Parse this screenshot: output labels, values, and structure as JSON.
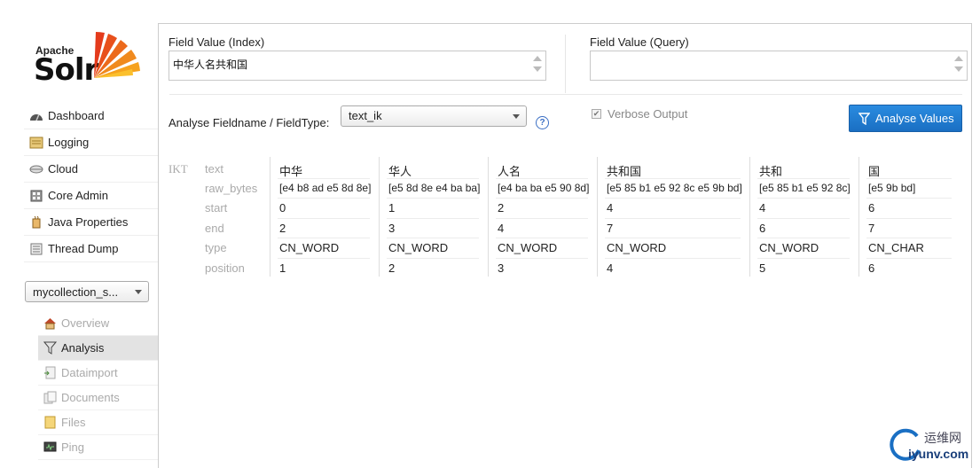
{
  "logo": {
    "apache": "Apache",
    "solr": "Solr"
  },
  "nav": [
    {
      "label": "Dashboard",
      "icon": "dashboard-icon"
    },
    {
      "label": "Logging",
      "icon": "logging-icon"
    },
    {
      "label": "Cloud",
      "icon": "cloud-icon"
    },
    {
      "label": "Core Admin",
      "icon": "core-admin-icon"
    },
    {
      "label": "Java Properties",
      "icon": "java-properties-icon"
    },
    {
      "label": "Thread Dump",
      "icon": "thread-dump-icon"
    }
  ],
  "core_selector": {
    "value": "mycollection_s..."
  },
  "core_menu": [
    {
      "label": "Overview",
      "icon": "home-icon",
      "active": false
    },
    {
      "label": "Analysis",
      "icon": "funnel-icon",
      "active": true
    },
    {
      "label": "Dataimport",
      "icon": "dataimport-icon",
      "active": false
    },
    {
      "label": "Documents",
      "icon": "documents-icon",
      "active": false
    },
    {
      "label": "Files",
      "icon": "files-icon",
      "active": false
    },
    {
      "label": "Ping",
      "icon": "ping-icon",
      "active": false
    }
  ],
  "analysis": {
    "index_label": "Field Value (Index)",
    "index_value": "中华人名共和国",
    "query_label": "Field Value (Query)",
    "query_value": "",
    "fieldtype_label": "Analyse Fieldname / FieldType:",
    "fieldtype_value": "text_ik",
    "verbose_label": "Verbose Output",
    "verbose_checked": true,
    "button_label": "Analyse Values",
    "button_color": "#1f7ad0"
  },
  "results": {
    "tokenizer": "IKT",
    "row_labels": [
      "text",
      "raw_bytes",
      "start",
      "end",
      "type",
      "position"
    ],
    "tokens": [
      {
        "text": "中华",
        "raw_bytes": "[e4 b8 ad e5 8d 8e]",
        "start": "0",
        "end": "2",
        "type": "CN_WORD",
        "position": "1"
      },
      {
        "text": "华人",
        "raw_bytes": "[e5 8d 8e e4 ba ba]",
        "start": "1",
        "end": "3",
        "type": "CN_WORD",
        "position": "2"
      },
      {
        "text": "人名",
        "raw_bytes": "[e4 ba ba e5 90 8d]",
        "start": "2",
        "end": "4",
        "type": "CN_WORD",
        "position": "3"
      },
      {
        "text": "共和国",
        "raw_bytes": "[e5 85 b1 e5 92 8c e5 9b bd]",
        "start": "4",
        "end": "7",
        "type": "CN_WORD",
        "position": "4"
      },
      {
        "text": "共和",
        "raw_bytes": "[e5 85 b1 e5 92 8c]",
        "start": "4",
        "end": "6",
        "type": "CN_WORD",
        "position": "5"
      },
      {
        "text": "国",
        "raw_bytes": "[e5 9b bd]",
        "start": "6",
        "end": "7",
        "type": "CN_CHAR",
        "position": "6"
      }
    ]
  },
  "watermark": {
    "cn": "运维网",
    "en": "iyunv.com"
  }
}
